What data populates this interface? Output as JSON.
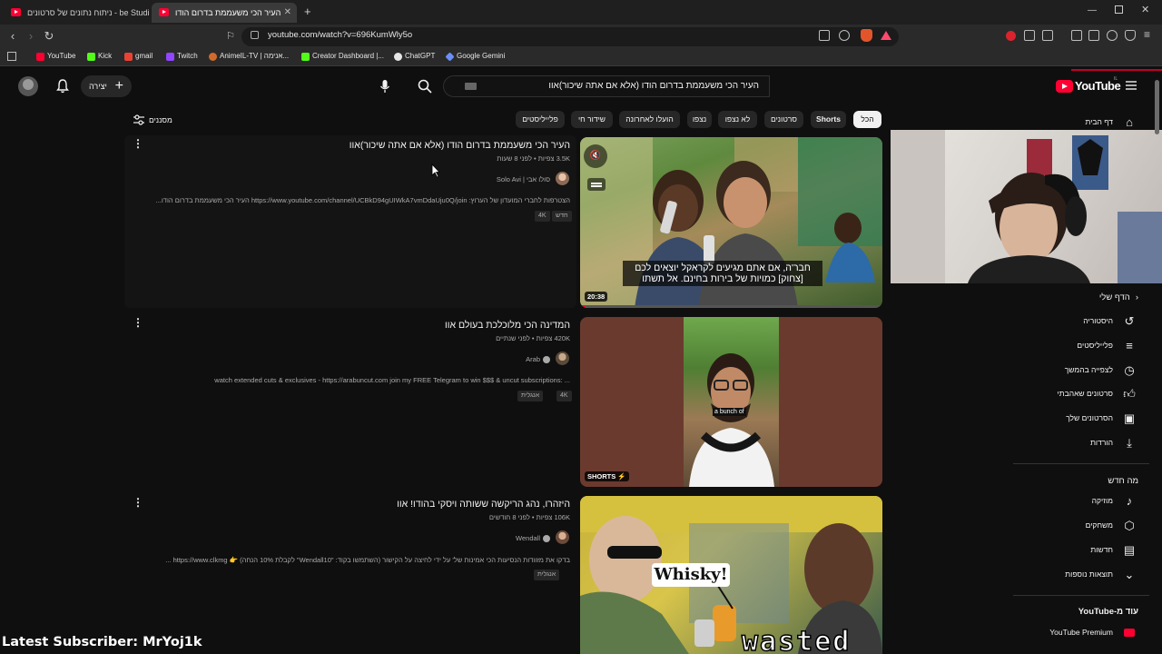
{
  "browser": {
    "tabs": [
      {
        "label": "ניתוח נתונים של סרטונים - be Studio",
        "active": false
      },
      {
        "label": "העיר הכי משעממת בדרום הודו",
        "active": true
      }
    ],
    "new_tab": "+",
    "url": "youtube.com/watch?v=696KumWly5o",
    "bookmarks": [
      "YouTube",
      "Kick",
      "gmail",
      "Twitch",
      "AnimeIL-TV | אנימה...",
      "Creator Dashboard |...",
      "ChatGPT",
      "Google Gemini"
    ]
  },
  "header": {
    "create_label": "יצירה",
    "search_query": "העיר הכי משעממת בדרום הודו (אלא אם אתה שיכור)אוו",
    "logo_text": "YouTube",
    "logo_sup": "IL"
  },
  "filters": {
    "chips": [
      "הכל",
      "Shorts",
      "סרטונים",
      "לא נצפו",
      "נצפו",
      "הועלו לאחרונה",
      "שידור חי",
      "פלייליסטים"
    ],
    "filters_label": "מסננים"
  },
  "results": [
    {
      "title": "העיר הכי משעממת בדרום הודו (אלא אם אתה שיכור)אוו",
      "meta": "3.5K צפיות • לפני 8 שעות",
      "channel": "סולו אבי | Solo Avi",
      "description": "הצטרפות לחברי המועדון של הערוץ: https://www.youtube.com/channel/UCBkD94gUIWkA7vmDdaUju0Q/join העיר הכי משעממת בדרום הודו...",
      "badges": [
        "חדש",
        "4K"
      ],
      "duration": "20:38",
      "caption_line1": "חבר'ה, אם אתם מגיעים לקראקל יוצאים לכם",
      "caption_line2": "[צחוק] כמויות של בירות בחינם. אל תשתו"
    },
    {
      "title": "המדינה הכי מלוכלכת בעולם אוו",
      "meta": "420K צפיות • לפני שנתיים",
      "channel": "Arab",
      "description": "watch extended cuts & exclusives - https://arabuncut.com join my FREE Telegram to win $$$ & uncut subscriptions: ...",
      "badges": [
        "אנגלית",
        "4K"
      ],
      "shorts_label": "SHORTS",
      "caption": "a bunch of"
    },
    {
      "title": "היזהרו, נהג הריקשה ששותה ויסקי בהודו! אוו",
      "meta": "106K צפיות • לפני 8 חודשים",
      "channel": "Wendall",
      "description": "בדקו את מזוודות הנסיעות הכי אמינות של' על ידי לחיצה על הקישור (השתמשו בקוד: \"Wendall10\" לקבלת 10% הנחה) 👉 https://www.clkmg ...",
      "badges": [
        "אנגלית"
      ],
      "thumb_text1": "Whisky!",
      "thumb_text2": "wasted"
    }
  ],
  "sidebar": {
    "home": "דף הבית",
    "you_header": "הדף שלי",
    "you_items": [
      "היסטוריה",
      "פלייליסטים",
      "לצפייה בהמשך",
      "סרטונים שאהבתי",
      "הסרטונים שלך",
      "הורדות"
    ],
    "explore_header": "מה חדש",
    "explore_items": [
      "מוזיקה",
      "משחקים",
      "חדשות",
      "תוצאות נוספות"
    ],
    "more_header": "עוד מ-YouTube",
    "more_items": [
      "YouTube Premium"
    ]
  },
  "stream_overlay": "Latest Subscriber: MrYoj1k",
  "colors": {
    "brand": "#ff0033",
    "background": "#0f0f0f",
    "chip": "#272727"
  }
}
